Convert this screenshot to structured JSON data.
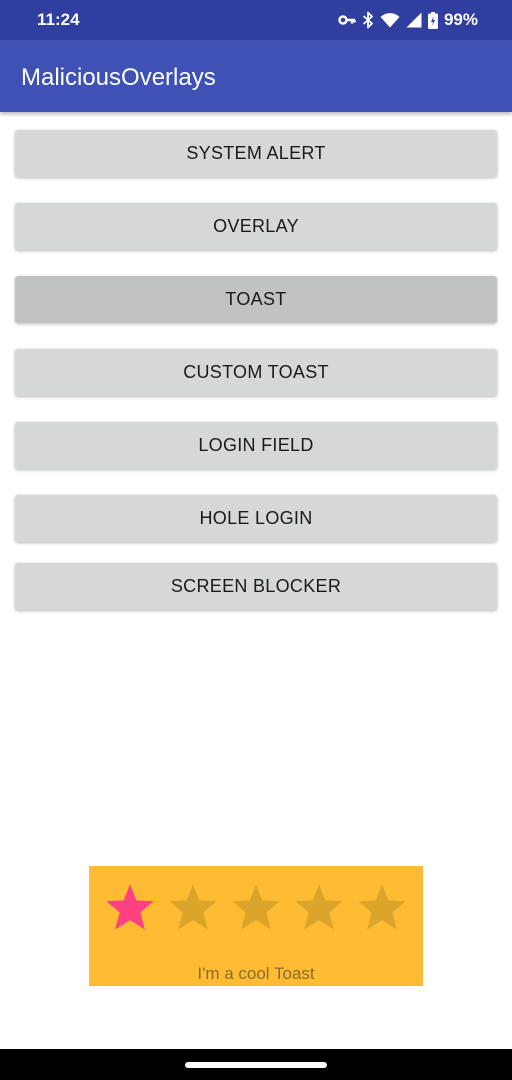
{
  "status_bar": {
    "time": "11:24",
    "battery_percent": "99%",
    "icons": [
      "vpn-key-icon",
      "bluetooth-icon",
      "wifi-icon",
      "cell-signal-icon",
      "battery-icon"
    ]
  },
  "app_bar": {
    "title": "MaliciousOverlays",
    "color": "#3f51b5",
    "status_color": "#303f9f"
  },
  "buttons": [
    {
      "label": "SYSTEM ALERT"
    },
    {
      "label": "OVERLAY"
    },
    {
      "label": "TOAST",
      "pressed": true
    },
    {
      "label": "CUSTOM TOAST"
    },
    {
      "label": "LOGIN FIELD"
    },
    {
      "label": "HOLE LOGIN"
    },
    {
      "label": "SCREEN BLOCKER"
    }
  ],
  "toast": {
    "text": "I'm a cool Toast",
    "background": "#ffbb33",
    "rating": 1,
    "max_rating": 5,
    "filled_star_color": "#ff4081",
    "empty_star_color": "#dba42b"
  }
}
